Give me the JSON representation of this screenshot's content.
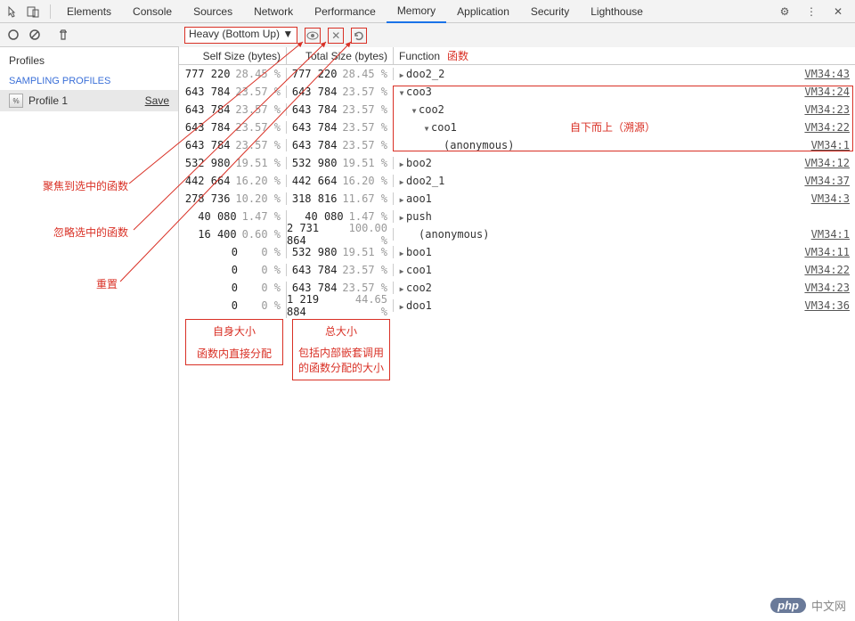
{
  "topbar": {
    "tabs": [
      "Elements",
      "Console",
      "Sources",
      "Network",
      "Performance",
      "Memory",
      "Application",
      "Security",
      "Lighthouse"
    ],
    "active_tab": "Memory"
  },
  "sidebar": {
    "profiles_label": "Profiles",
    "section": "SAMPLING PROFILES",
    "profile_name": "Profile 1",
    "save_label": "Save"
  },
  "toolbar": {
    "view": "Heavy (Bottom Up) ▼"
  },
  "headers": {
    "self": "Self Size (bytes)",
    "total": "Total Size (bytes)",
    "func": "Function",
    "func_cn": "函数"
  },
  "rows": [
    {
      "self_v": "777 220",
      "self_p": "28.45 %",
      "total_v": "777 220",
      "total_p": "28.45 %",
      "func": "doo2_2",
      "indent": 0,
      "tri": "closed",
      "src": "VM34:43"
    },
    {
      "self_v": "643 784",
      "self_p": "23.57 %",
      "total_v": "643 784",
      "total_p": "23.57 %",
      "func": "coo3",
      "indent": 0,
      "tri": "open",
      "src": "VM34:24",
      "hl": true
    },
    {
      "self_v": "643 784",
      "self_p": "23.57 %",
      "total_v": "643 784",
      "total_p": "23.57 %",
      "func": "coo2",
      "indent": 1,
      "tri": "open",
      "src": "VM34:23",
      "hl": true
    },
    {
      "self_v": "643 784",
      "self_p": "23.57 %",
      "total_v": "643 784",
      "total_p": "23.57 %",
      "func": "coo1",
      "indent": 2,
      "tri": "open",
      "src": "VM34:22",
      "hl": true
    },
    {
      "self_v": "643 784",
      "self_p": "23.57 %",
      "total_v": "643 784",
      "total_p": "23.57 %",
      "func": "(anonymous)",
      "indent": 3,
      "tri": "",
      "src": "VM34:1",
      "hl": true
    },
    {
      "self_v": "532 980",
      "self_p": "19.51 %",
      "total_v": "532 980",
      "total_p": "19.51 %",
      "func": "boo2",
      "indent": 0,
      "tri": "closed",
      "src": "VM34:12"
    },
    {
      "self_v": "442 664",
      "self_p": "16.20 %",
      "total_v": "442 664",
      "total_p": "16.20 %",
      "func": "doo2_1",
      "indent": 0,
      "tri": "closed",
      "src": "VM34:37"
    },
    {
      "self_v": "278 736",
      "self_p": "10.20 %",
      "total_v": "318 816",
      "total_p": "11.67 %",
      "func": "aoo1",
      "indent": 0,
      "tri": "closed",
      "src": "VM34:3"
    },
    {
      "self_v": "40 080",
      "self_p": "1.47 %",
      "total_v": "40 080",
      "total_p": "1.47 %",
      "func": "push",
      "indent": 0,
      "tri": "closed",
      "src": ""
    },
    {
      "self_v": "16 400",
      "self_p": "0.60 %",
      "total_v": "2 731 864",
      "total_p": "100.00 %",
      "func": "(anonymous)",
      "indent": 1,
      "tri": "",
      "src": "VM34:1"
    },
    {
      "self_v": "0",
      "self_p": "0 %",
      "total_v": "532 980",
      "total_p": "19.51 %",
      "func": "boo1",
      "indent": 0,
      "tri": "closed",
      "src": "VM34:11"
    },
    {
      "self_v": "0",
      "self_p": "0 %",
      "total_v": "643 784",
      "total_p": "23.57 %",
      "func": "coo1",
      "indent": 0,
      "tri": "closed",
      "src": "VM34:22"
    },
    {
      "self_v": "0",
      "self_p": "0 %",
      "total_v": "643 784",
      "total_p": "23.57 %",
      "func": "coo2",
      "indent": 0,
      "tri": "closed",
      "src": "VM34:23"
    },
    {
      "self_v": "0",
      "self_p": "0 %",
      "total_v": "1 219 884",
      "total_p": "44.65 %",
      "func": "doo1",
      "indent": 0,
      "tri": "closed",
      "src": "VM34:36"
    }
  ],
  "annotations": {
    "box_self_1": "自身大小",
    "box_self_2": "函数内直接分配",
    "box_total_1": "总大小",
    "box_total_2": "包括内部嵌套调用的函数分配的大小",
    "bottom_up": "自下而上（溯源）",
    "focus": "聚焦到选中的函数",
    "ignore": "忽略选中的函数",
    "reset": "重置"
  },
  "watermark": {
    "badge": "php",
    "text": "中文网"
  }
}
